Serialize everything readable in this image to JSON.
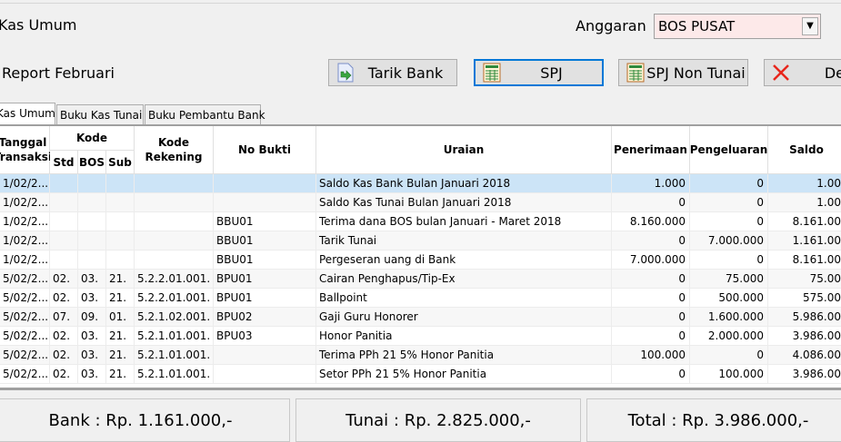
{
  "header": {
    "title": "Kas Umum",
    "anggaran_label": "Anggaran",
    "anggaran_value": "BOS PUSAT",
    "report": "Report Februari"
  },
  "toolbar": {
    "tarik_bank": "Tarik Bank",
    "spj": "SPJ",
    "spj_non_tunai": "SPJ Non Tunai",
    "delete": "De"
  },
  "tabs": [
    "Kas Umum",
    "Buku Kas Tunai",
    "Buku Pembantu Bank"
  ],
  "columns": {
    "tanggal": "Tanggal\nTransaksi",
    "kode": "Kode",
    "std": "Std",
    "bos": "BOS",
    "sub": "Sub",
    "kode_rekening": "Kode\nRekening",
    "no_bukti": "No Bukti",
    "uraian": "Uraian",
    "penerimaan": "Penerimaan",
    "pengeluaran": "Pengeluaran",
    "saldo": "Saldo"
  },
  "rows": [
    [
      "1/02/2...",
      "",
      "",
      "",
      "",
      "",
      "Saldo Kas Bank Bulan Januari 2018",
      "1.000",
      "0",
      "1.00"
    ],
    [
      "1/02/2...",
      "",
      "",
      "",
      "",
      "",
      "Saldo Kas Tunai Bulan Januari 2018",
      "0",
      "0",
      "1.00"
    ],
    [
      "1/02/2...",
      "",
      "",
      "",
      "",
      "BBU01",
      "Terima dana BOS bulan Januari - Maret 2018",
      "8.160.000",
      "0",
      "8.161.00"
    ],
    [
      "1/02/2...",
      "",
      "",
      "",
      "",
      "BBU01",
      "Tarik Tunai",
      "0",
      "7.000.000",
      "1.161.00"
    ],
    [
      "1/02/2...",
      "",
      "",
      "",
      "",
      "BBU01",
      "Pergeseran uang di Bank",
      "7.000.000",
      "0",
      "8.161.00"
    ],
    [
      "5/02/2...",
      "02.",
      "03.",
      "21.",
      "5.2.2.01.001.",
      "BPU01",
      "Cairan Penghapus/Tip-Ex",
      "0",
      "75.000",
      "75.00"
    ],
    [
      "5/02/2...",
      "02.",
      "03.",
      "21.",
      "5.2.2.01.001.",
      "BPU01",
      "Ballpoint",
      "0",
      "500.000",
      "575.00"
    ],
    [
      "5/02/2...",
      "07.",
      "09.",
      "01.",
      "5.2.1.02.001.",
      "BPU02",
      "Gaji Guru Honorer",
      "0",
      "1.600.000",
      "5.986.00"
    ],
    [
      "5/02/2...",
      "02.",
      "03.",
      "21.",
      "5.2.1.01.001.",
      "BPU03",
      "Honor Panitia",
      "0",
      "2.000.000",
      "3.986.00"
    ],
    [
      "5/02/2...",
      "02.",
      "03.",
      "21.",
      "5.2.1.01.001.",
      "",
      "Terima PPh 21 5% Honor Panitia",
      "100.000",
      "0",
      "4.086.00"
    ],
    [
      "5/02/2...",
      "02.",
      "03.",
      "21.",
      "5.2.1.01.001.",
      "",
      "Setor PPh 21 5% Honor Panitia",
      "0",
      "100.000",
      "3.986.00"
    ]
  ],
  "totals": {
    "bank": "Bank : Rp. 1.161.000,-",
    "tunai": "Tunai : Rp. 2.825.000,-",
    "total": "Total : Rp. 3.986.000,-"
  },
  "colors": {
    "selected_row": "#cce4f7",
    "focus_border": "#0078d7",
    "select_bg": "#fde9e9"
  }
}
